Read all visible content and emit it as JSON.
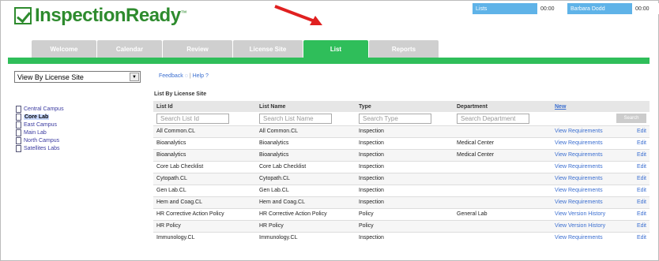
{
  "header": {
    "logo_text": "InspectionReady",
    "tm": "™",
    "top1": "Lists",
    "time1": "00:00",
    "user": "Barbara Dodd",
    "time2": "00:00"
  },
  "tabs": [
    "Welcome",
    "Calendar",
    "Review",
    "License Site",
    "List",
    "Reports"
  ],
  "active_tab": "List",
  "left": {
    "view_select": "View By License Site",
    "tree": [
      "Central Campus",
      "Core Lab",
      "East Campus",
      "Main Lab",
      "North Campus",
      "Satellites Labs"
    ],
    "selected": "Core Lab"
  },
  "help": {
    "feedback": "Feedback",
    "sep": "|",
    "help": "Help"
  },
  "page_title": "List By License Site",
  "table": {
    "headers": [
      "List Id",
      "List Name",
      "Type",
      "Department"
    ],
    "new_label": "New",
    "search_placeholders": [
      "Search List Id",
      "Search List Name",
      "Search Type",
      "Search Department"
    ],
    "search_button": "Search",
    "rows": [
      {
        "id": "All Common.CL",
        "name": "All Common.CL",
        "type": "Inspection",
        "dept": "",
        "action": "View Requirements",
        "edit": "Edit"
      },
      {
        "id": "Bioanalytics",
        "name": "Bioanalytics",
        "type": "Inspection",
        "dept": "Medical Center",
        "action": "View Requirements",
        "edit": "Edit"
      },
      {
        "id": "Bioanalytics",
        "name": "Bioanalytics",
        "type": "Inspection",
        "dept": "Medical Center",
        "action": "View Requirements",
        "edit": "Edit"
      },
      {
        "id": "Core Lab Checklist",
        "name": "Core Lab Checklist",
        "type": "Inspection",
        "dept": "",
        "action": "View Requirements",
        "edit": "Edit"
      },
      {
        "id": "Cytopath.CL",
        "name": "Cytopath.CL",
        "type": "Inspection",
        "dept": "",
        "action": "View Requirements",
        "edit": "Edit"
      },
      {
        "id": "Gen Lab.CL",
        "name": "Gen Lab.CL",
        "type": "Inspection",
        "dept": "",
        "action": "View Requirements",
        "edit": "Edit"
      },
      {
        "id": "Hem and Coag.CL",
        "name": "Hem and Coag.CL",
        "type": "Inspection",
        "dept": "",
        "action": "View Requirements",
        "edit": "Edit"
      },
      {
        "id": "HR Corrective Action Policy",
        "name": "HR Corrective Action Policy",
        "type": "Policy",
        "dept": "General Lab",
        "action": "View Version History",
        "edit": "Edit"
      },
      {
        "id": "HR Policy",
        "name": "HR Policy",
        "type": "Policy",
        "dept": "",
        "action": "View Version History",
        "edit": "Edit"
      },
      {
        "id": "Immunology.CL",
        "name": "Immunology.CL",
        "type": "Inspection",
        "dept": "",
        "action": "View Requirements",
        "edit": "Edit"
      }
    ]
  },
  "colors": {
    "brand": "#2e8b2e",
    "tab_active": "#2fbe5a",
    "link": "#3a6ed0",
    "arrow": "#e02020"
  }
}
